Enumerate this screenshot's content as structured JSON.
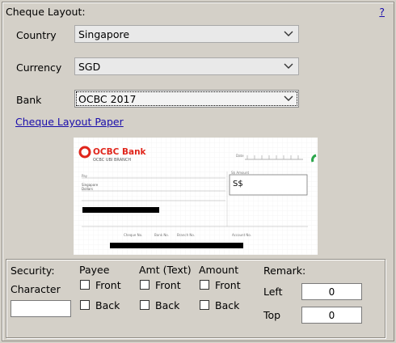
{
  "header": {
    "title": "Cheque Layout:",
    "help_label": "?"
  },
  "fields": {
    "country": {
      "label": "Country",
      "value": "Singapore"
    },
    "currency": {
      "label": "Currency",
      "value": "SGD"
    },
    "bank": {
      "label": "Bank",
      "value": "OCBC 2017"
    }
  },
  "paper_link": "Cheque Layout Paper",
  "cheque_preview": {
    "bank_name": "OCBC Bank",
    "branch": "OCBC UBI BRANCH",
    "currency_symbol": "S$",
    "pay_label": "Pay",
    "singapore_text": "Singapore",
    "dollars_text": "Dollars",
    "date_label": "Date",
    "amount_label": "S$ Amount",
    "cheque_no": "Cheque No.",
    "bank_no": "Bank No.",
    "branch_no": "Branch No.",
    "account_no": "Account No."
  },
  "settings": {
    "security_label": "Security:",
    "character_label": "Character",
    "character_value": "",
    "payee_label": "Payee",
    "amt_text_label": "Amt (Text)",
    "amount_label": "Amount",
    "front_label": "Front",
    "back_label": "Back",
    "remark_label": "Remark:",
    "left_label": "Left",
    "left_value": "0",
    "top_label": "Top",
    "top_value": "0"
  },
  "colors": {
    "link": "#1a0dab",
    "ocbc_red": "#e0251b",
    "background": "#d4d0c8"
  },
  "icons": [
    "chevron-down-icon",
    "ocbc-logo-icon",
    "help-icon"
  ]
}
